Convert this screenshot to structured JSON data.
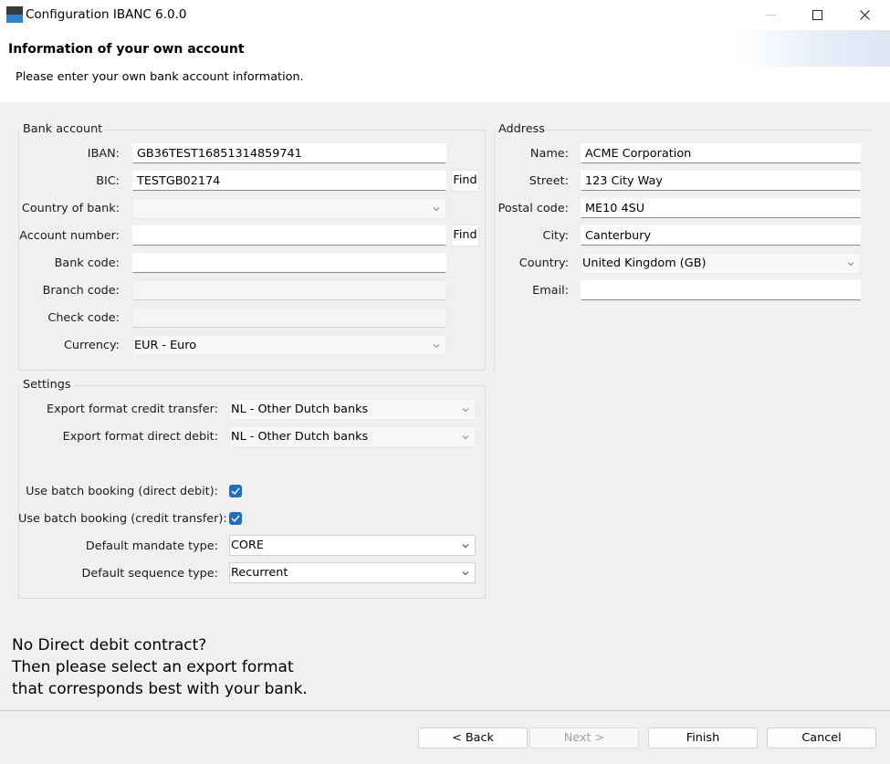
{
  "window": {
    "title": "Configuration IBANC 6.0.0"
  },
  "header": {
    "title": "Information of your own account",
    "subtitle": "Please enter your own bank account information."
  },
  "bank_account": {
    "group_title": "Bank account",
    "iban_label": "IBAN:",
    "iban_value": "GB36TEST16851314859741",
    "bic_label": "BIC:",
    "bic_value": "TESTGB02174",
    "find_label": "Find",
    "country_label": "Country of bank:",
    "country_value": "",
    "account_number_label": "Account number:",
    "account_number_value": "",
    "bank_code_label": "Bank code:",
    "bank_code_value": "",
    "branch_code_label": "Branch code:",
    "branch_code_value": "",
    "check_code_label": "Check code:",
    "check_code_value": "",
    "currency_label": "Currency:",
    "currency_value": "EUR - Euro"
  },
  "address": {
    "group_title": "Address",
    "name_label": "Name:",
    "name_value": "ACME Corporation",
    "street_label": "Street:",
    "street_value": "123 City Way",
    "postal_label": "Postal code:",
    "postal_value": "ME10 4SU",
    "city_label": "City:",
    "city_value": "Canterbury",
    "country_label": "Country:",
    "country_value": "United Kingdom (GB)",
    "email_label": "Email:",
    "email_value": ""
  },
  "settings": {
    "group_title": "Settings",
    "export_credit_label": "Export format credit transfer:",
    "export_credit_value": "NL - Other Dutch banks",
    "export_debit_label": "Export format direct debit:",
    "export_debit_value": "NL - Other Dutch banks",
    "batch_debit_label": "Use batch booking (direct debit):",
    "batch_debit_checked": true,
    "batch_credit_label": "Use batch booking (credit transfer):",
    "batch_credit_checked": true,
    "mandate_label": "Default mandate type:",
    "mandate_value": "CORE",
    "sequence_label": "Default sequence type:",
    "sequence_value": "Recurrent"
  },
  "note": {
    "line1": "No Direct debit contract?",
    "line2": "Then please select an export format",
    "line3": "that corresponds best with your bank."
  },
  "footer": {
    "back_label": "< Back",
    "next_label": "Next >",
    "finish_label": "Finish",
    "cancel_label": "Cancel"
  },
  "colors": {
    "accent": "#1f6fc1",
    "app_icon_top": "#3a3a3a",
    "app_icon_bottom": "#2f82c8"
  }
}
